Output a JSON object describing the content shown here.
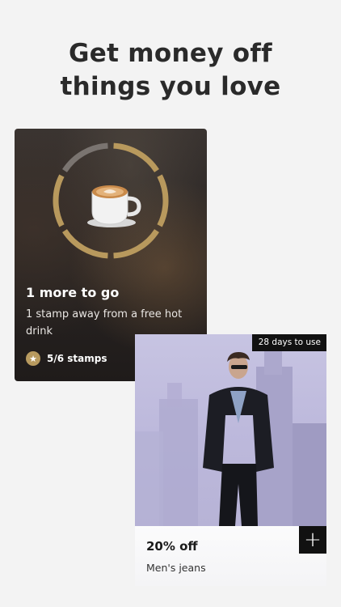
{
  "headline": {
    "line1": "Get money off",
    "line2": "things you love"
  },
  "stamp_card": {
    "title": "1 more to go",
    "subtitle": "1 stamp away from a free hot drink",
    "count_label": "5/6 stamps",
    "stamps_collected": 5,
    "stamps_total": 6,
    "icons": [
      "coffee-cup-icon",
      "star-icon"
    ],
    "colors": {
      "ring_filled": "#b8995d",
      "ring_empty": "#7a7470",
      "badge": "#b89a5f"
    }
  },
  "offer_card": {
    "badge": "28 days to use",
    "title": "20% off",
    "subtitle": "Men's jeans",
    "add_icon": "+"
  }
}
